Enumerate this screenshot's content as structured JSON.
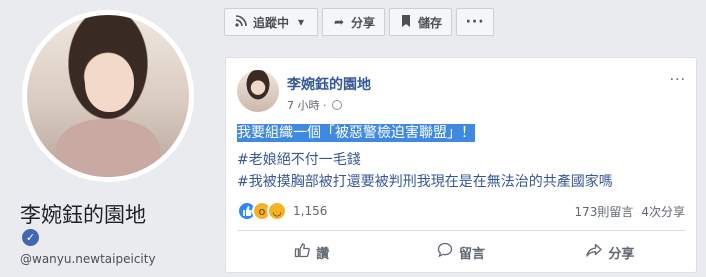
{
  "profile": {
    "name": "李婉鈺的園地",
    "handle": "@wanyu.newtaipeicity"
  },
  "action_bar": {
    "follow_label": "追蹤中",
    "share_label": "分享",
    "save_label": "儲存",
    "more_label": "···"
  },
  "post": {
    "author": "李婉鈺的園地",
    "time": "7 小時 ·",
    "line1": "我要組織一個「被惡警檢迫害聯盟」！",
    "line2": "#老娘絕不付一毛錢",
    "line3": "#我被摸胸部被打還要被判刑我現在是在無法治的共產國家嗎",
    "reaction_count": "1,156",
    "comments": "173則留言",
    "shares": "4次分享",
    "more_label": "···"
  },
  "footer": {
    "like_label": "讚",
    "comment_label": "留言",
    "share_label": "分享"
  },
  "icons": {
    "like": "thumbs-up-icon",
    "comment": "speech-bubble-icon",
    "share": "share-arrow-icon",
    "follow": "rss-icon",
    "save": "bookmark-icon"
  },
  "colors": {
    "link_blue": "#365899",
    "highlight": "#3f8ae0",
    "verified_blue": "#4267b2"
  }
}
